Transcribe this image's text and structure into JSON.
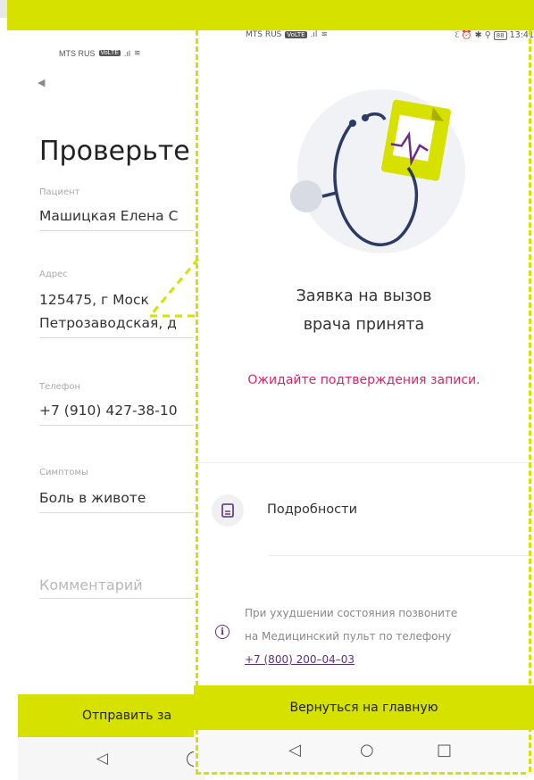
{
  "back_screen": {
    "status": {
      "carrier": "MTS RUS",
      "volte": "VoLTE",
      "signal": ".ıl",
      "wifi": "≋"
    },
    "back_icon": "back-triangle-icon",
    "title": "Проверьте д",
    "fields": [
      {
        "label": "Пациент",
        "value": "Машицкая Елена С"
      },
      {
        "label": "Адрес",
        "value": "125475, г Моск",
        "value2": "Петрозаводская, д"
      },
      {
        "label": "Телефон",
        "value": "+7 (910) 427-38-10"
      },
      {
        "label": "Симптомы",
        "value": "Боль в животе"
      }
    ],
    "comment_placeholder": "Комментарий",
    "send_button": "Отправить за",
    "nav": {
      "back": "◁",
      "home": "◯"
    }
  },
  "front_screen": {
    "status": {
      "carrier": "MTS RUS",
      "volte": "VoLTE",
      "signal": ".ıl",
      "wifi": "≋",
      "icons": "ᦷ ⏰ ✱ ⚲",
      "battery": "88",
      "time": "13:41"
    },
    "illustration": "stethoscope-document-icon",
    "success_title_line1": "Заявка на вызов",
    "success_title_line2": "врача принята",
    "wait_message": "Ожидайте подтверждения записи.",
    "details": {
      "icon": "document-icon",
      "label": "Подробности",
      "chevron": "›"
    },
    "info": {
      "icon": "info-icon",
      "line1": "При ухудшении состояния позвоните",
      "line2": "на Медицинский пульт по телефону",
      "phone": "+7 (800) 200–04–03"
    },
    "home_button": "Вернуться на главную",
    "nav": {
      "back": "◁",
      "home": "○",
      "recent": "□"
    }
  },
  "colors": {
    "accent": "#d6e100",
    "pink": "#d6266b",
    "purple": "#5b2f7a"
  }
}
